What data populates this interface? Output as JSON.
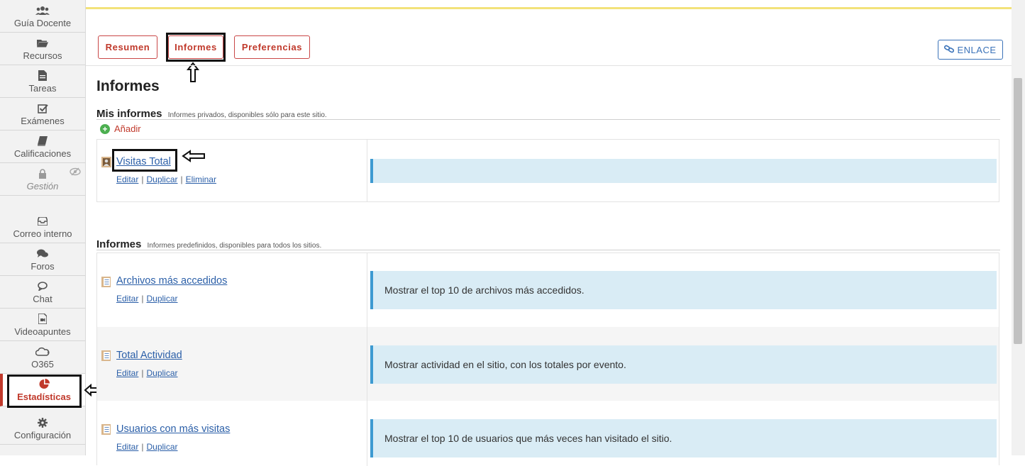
{
  "sidebar": {
    "items": [
      {
        "label": "Guía Docente",
        "icon": "users-icon"
      },
      {
        "label": "Recursos",
        "icon": "folder-icon"
      },
      {
        "label": "Tareas",
        "icon": "file-icon"
      },
      {
        "label": "Exámenes",
        "icon": "checkbox-icon"
      },
      {
        "label": "Calificaciones",
        "icon": "book-icon"
      },
      {
        "label": "Gestión",
        "icon": "lock-icon"
      },
      {
        "label": "Correo interno",
        "icon": "inbox-icon"
      },
      {
        "label": "Foros",
        "icon": "chat-bubbles-icon"
      },
      {
        "label": "Chat",
        "icon": "chat-icon"
      },
      {
        "label": "Videoapuntes",
        "icon": "video-file-icon"
      },
      {
        "label": "O365",
        "icon": "cloud-icon"
      },
      {
        "label": "Estadísticas",
        "icon": "pie-chart-icon"
      },
      {
        "label": "Configuración",
        "icon": "gear-icon"
      }
    ]
  },
  "tabs": [
    {
      "label": "Resumen"
    },
    {
      "label": "Informes"
    },
    {
      "label": "Preferencias"
    }
  ],
  "enlace_label": "ENLACE",
  "page_title": "Informes",
  "my_reports": {
    "title": "Mis informes",
    "subtitle": "Informes privados, disponibles sólo para este sitio.",
    "add_label": "Añadir",
    "items": [
      {
        "title": "Visitas Total",
        "edit": "Editar",
        "duplicate": "Duplicar",
        "delete": "Eliminar",
        "description": ""
      }
    ]
  },
  "predefined_reports": {
    "title": "Informes",
    "subtitle": "Informes predefinidos, disponibles para todos los sitios.",
    "items": [
      {
        "title": "Archivos más accedidos",
        "edit": "Editar",
        "duplicate": "Duplicar",
        "description": "Mostrar el top 10 de archivos más accedidos."
      },
      {
        "title": "Total Actividad",
        "edit": "Editar",
        "duplicate": "Duplicar",
        "description": "Mostrar actividad en el sitio, con los totales por evento."
      },
      {
        "title": "Usuarios con más visitas",
        "edit": "Editar",
        "duplicate": "Duplicar",
        "description": "Mostrar el top 10 de usuarios que más veces han visitado el sitio."
      }
    ]
  },
  "colors": {
    "accent_red": "#c0392b",
    "link_blue": "#2b5fa8",
    "desc_bg": "#d9ecf5",
    "desc_border": "#3d9ad1"
  }
}
